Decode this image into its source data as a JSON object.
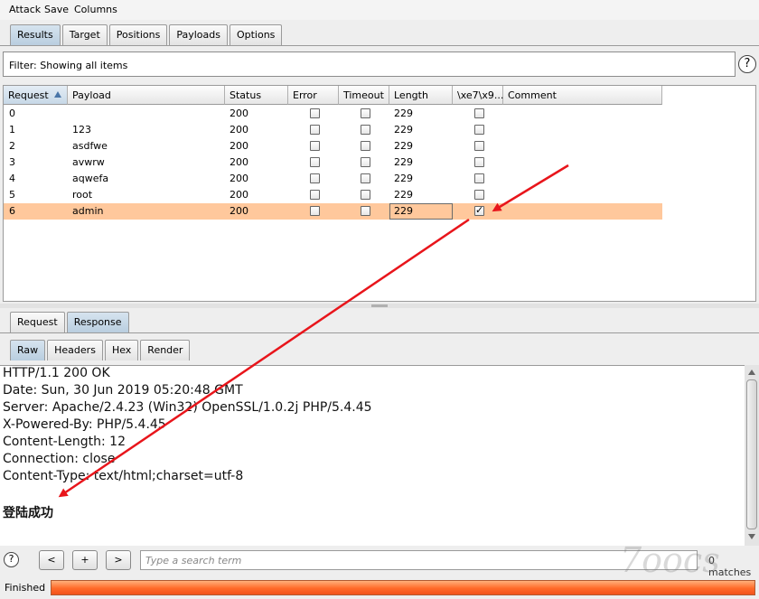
{
  "menu": [
    "Attack",
    "Save",
    "Columns"
  ],
  "tabs": [
    "Results",
    "Target",
    "Positions",
    "Payloads",
    "Options"
  ],
  "filter": {
    "text": "Filter: Showing all items"
  },
  "help_icon": "help-icon",
  "table": {
    "columns": [
      "Request",
      "Payload",
      "Status",
      "Error",
      "Timeout",
      "Length",
      "\\xe7\\x9...",
      "Comment"
    ],
    "rows": [
      {
        "request": "0",
        "payload": "",
        "status": "200",
        "error": false,
        "timeout": false,
        "length": "229",
        "grep": false,
        "comment": ""
      },
      {
        "request": "1",
        "payload": "123",
        "status": "200",
        "error": false,
        "timeout": false,
        "length": "229",
        "grep": false,
        "comment": ""
      },
      {
        "request": "2",
        "payload": "asdfwe",
        "status": "200",
        "error": false,
        "timeout": false,
        "length": "229",
        "grep": false,
        "comment": ""
      },
      {
        "request": "3",
        "payload": "avwrw",
        "status": "200",
        "error": false,
        "timeout": false,
        "length": "229",
        "grep": false,
        "comment": ""
      },
      {
        "request": "4",
        "payload": "aqwefa",
        "status": "200",
        "error": false,
        "timeout": false,
        "length": "229",
        "grep": false,
        "comment": ""
      },
      {
        "request": "5",
        "payload": "root",
        "status": "200",
        "error": false,
        "timeout": false,
        "length": "229",
        "grep": false,
        "comment": ""
      },
      {
        "request": "6",
        "payload": "admin",
        "status": "200",
        "error": false,
        "timeout": false,
        "length": "229",
        "grep": true,
        "comment": ""
      }
    ],
    "selected_row": 6,
    "sorted_column": "Request"
  },
  "req_tabs": [
    "Request",
    "Response"
  ],
  "view_tabs": [
    "Raw",
    "Headers",
    "Hex",
    "Render"
  ],
  "response_lines": [
    "HTTP/1.1 200 OK",
    "Date: Sun, 30 Jun 2019 05:20:48 GMT",
    "Server: Apache/2.4.23 (Win32) OpenSSL/1.0.2j PHP/5.4.45",
    "X-Powered-By: PHP/5.4.45",
    "Content-Length: 12",
    "Connection: close",
    "Content-Type: text/html;charset=utf-8",
    "",
    "登陆成功"
  ],
  "search": {
    "prev": "<",
    "add": "+",
    "next": ">",
    "placeholder": "Type a search term",
    "matches": "0 matches"
  },
  "status": {
    "label": "Finished",
    "progress": 1.0
  },
  "watermark": "7oocs",
  "colors": {
    "selected_row": "#ffc89c",
    "progress": "#ff6a28",
    "arrow": "#e8151b",
    "active_tab": "#c3d5e4"
  }
}
